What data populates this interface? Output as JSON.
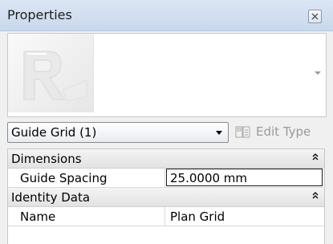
{
  "panel": {
    "title": "Properties",
    "close_icon": "close-icon"
  },
  "preview": {
    "thumbnail_icon": "revit-logo-icon",
    "dropdown_icon": "caret-down-icon"
  },
  "type_selector": {
    "selected": "Guide Grid (1)",
    "edit_type_label": "Edit Type",
    "edit_type_icon": "edit-type-icon"
  },
  "groups": [
    {
      "label": "Dimensions",
      "collapse_icon": "double-chevron-up-icon",
      "rows": [
        {
          "name": "Guide Spacing",
          "value": "25.0000 mm"
        }
      ]
    },
    {
      "label": "Identity Data",
      "collapse_icon": "double-chevron-up-icon",
      "rows": [
        {
          "name": "Name",
          "value": "Plan Grid"
        }
      ]
    }
  ],
  "colors": {
    "titlebar": "#c9d8ec",
    "disabled_text": "#9a9a9a",
    "group_header": "#e2e2e2"
  }
}
